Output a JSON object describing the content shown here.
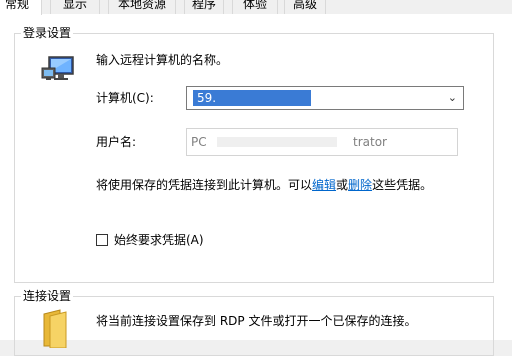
{
  "tabs": [
    {
      "label": "常规",
      "active": true
    },
    {
      "label": "显示",
      "active": false
    },
    {
      "label": "本地资源",
      "active": false
    },
    {
      "label": "程序",
      "active": false
    },
    {
      "label": "体验",
      "active": false
    },
    {
      "label": "高级",
      "active": false
    }
  ],
  "login_group": {
    "title": "登录设置",
    "prompt": "输入远程计算机的名称。",
    "computer_label": "计算机(C):",
    "computer_value": "59.",
    "username_label": "用户名:",
    "username_prefix": "PC",
    "username_suffix": "trator",
    "saved_text_before": "将使用保存的凭据连接到此计算机。可以",
    "edit_link": "编辑",
    "or_text": "或",
    "delete_link": "删除",
    "saved_text_after": "这些凭据。",
    "always_ask_label": "始终要求凭据(A)",
    "always_ask_checked": false
  },
  "connection_group": {
    "title": "连接设置",
    "description": "将当前连接设置保存到 RDP 文件或打开一个已保存的连接。"
  },
  "icons": {
    "computer": "computer-monitor-icon",
    "folder": "folder-icon",
    "dropdown": "chevron-down-icon"
  },
  "colors": {
    "link": "#0066cc",
    "selection": "#3a7bd5",
    "group_border": "#d9d9d9"
  }
}
